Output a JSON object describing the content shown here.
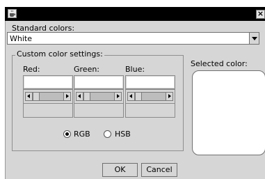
{
  "titlebar": {
    "close_glyph": "×",
    "icon": "coffee-cup-icon"
  },
  "standard": {
    "label": "Standard colors:",
    "selected": "White"
  },
  "custom": {
    "group_title": "Custom color settings:",
    "labels": {
      "red": "Red:",
      "green": "Green:",
      "blue": "Blue:"
    },
    "values": {
      "red": "",
      "green": "",
      "blue": ""
    },
    "modes": {
      "rgb": "RGB",
      "hsb": "HSB",
      "selected": "RGB"
    }
  },
  "selected_color": {
    "label": "Selected color:",
    "swatch_color": "#ffffff"
  },
  "buttons": {
    "ok": "OK",
    "cancel": "Cancel"
  }
}
